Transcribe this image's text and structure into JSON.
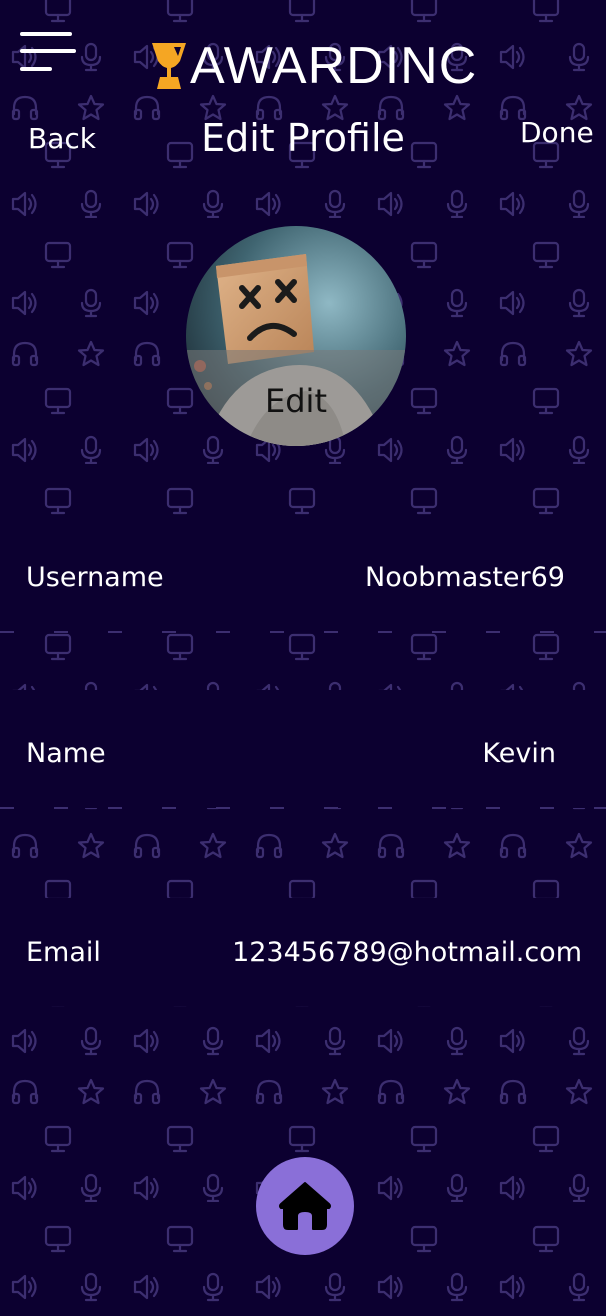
{
  "header": {
    "menu_icon": "hamburger-menu-icon",
    "logo_text": "AWARDINC",
    "logo_icon": "trophy-icon",
    "logo_color": "#f5a623"
  },
  "nav": {
    "back_label": "Back",
    "title": "Edit Profile",
    "done_label": "Done"
  },
  "avatar": {
    "edit_label": "Edit"
  },
  "fields": {
    "username": {
      "label": "Username",
      "value": "Noobmaster69"
    },
    "name": {
      "label": "Name",
      "value": "Kevin"
    },
    "email": {
      "label": "Email",
      "value": "123456789@hotmail.com"
    }
  },
  "footer": {
    "home_icon": "home-icon",
    "button_color": "#8a6fd8"
  },
  "theme": {
    "background": "#0c0030",
    "pattern_color": "#3c2e70",
    "text": "#ffffff"
  },
  "background_pattern_icons": [
    "monitor-icon",
    "speaker-icon",
    "microphone-icon",
    "headphones-icon",
    "star-icon"
  ]
}
